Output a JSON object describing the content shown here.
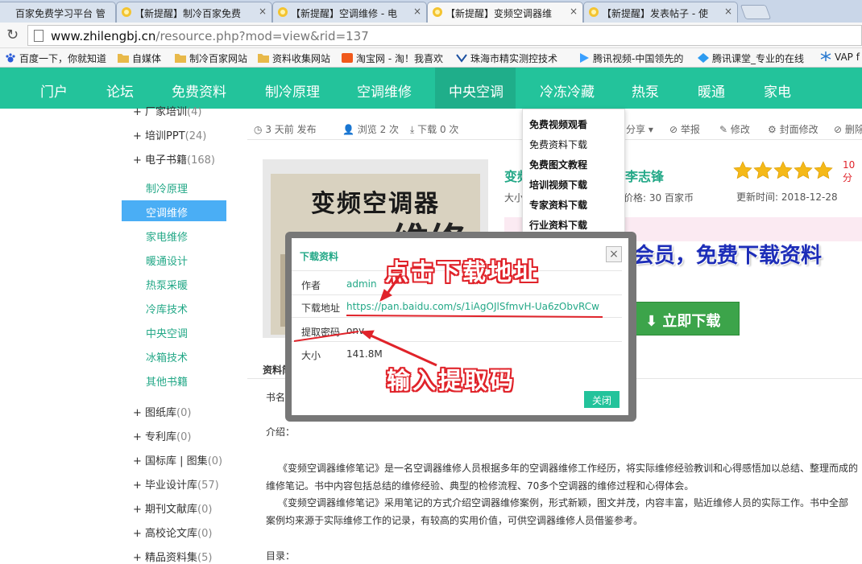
{
  "tabs": [
    {
      "label": "百家免费学习平台 管"
    },
    {
      "label": "【新提醒】制冷百家免费"
    },
    {
      "label": "【新提醒】空调维修 - 电"
    },
    {
      "label": "【新提醒】变频空调器维"
    },
    {
      "label": "【新提醒】发表帖子 - 使"
    }
  ],
  "address": {
    "domain": "www.zhilengbj.cn",
    "path": "/resource.php?mod=view&rid=137"
  },
  "bookmarks": [
    "百度一下，你就知道",
    "自媒体",
    "制冷百家网站",
    "资料收集网站",
    "淘宝网 - 淘！我喜欢",
    "珠海市精实测控技术",
    "腾讯视频-中国领先的",
    "腾讯课堂_专业的在线",
    "VAP f"
  ],
  "nav": [
    "门户",
    "论坛",
    "免费资料",
    "制冷原理",
    "空调维修",
    "中央空调",
    "冷冻冷藏",
    "热泵",
    "暖通",
    "家电"
  ],
  "sidebar": {
    "top": [
      {
        "label": "厂家培训",
        "count": "(4)"
      },
      {
        "label": "培训PPT",
        "count": "(24)"
      },
      {
        "label": "电子书籍",
        "count": "(168)"
      }
    ],
    "subs": [
      "制冷原理",
      "空调维修",
      "家电维修",
      "暖通设计",
      "热泵采暖",
      "冷库技术",
      "中央空调",
      "冰箱技术",
      "其他书籍"
    ],
    "bottom": [
      {
        "label": "图纸库",
        "count": "(0)"
      },
      {
        "label": "专利库",
        "count": "(0)"
      },
      {
        "label": "国标库 | 图集",
        "count": "(0)"
      },
      {
        "label": "毕业设计库",
        "count": "(57)"
      },
      {
        "label": "期刊文献库",
        "count": "(0)"
      },
      {
        "label": "高校论文库",
        "count": "(0)"
      },
      {
        "label": "精品资料集",
        "count": "(5)"
      }
    ]
  },
  "meta": {
    "time": "3 天前 发布",
    "views": "浏览 2 次",
    "downloads": "下载 0 次",
    "share": "分享",
    "report": "举报",
    "edit": "修改",
    "cover": "封面修改",
    "delete": "删除"
  },
  "dropdown": [
    "免费视频观看",
    "免费资料下载",
    "免费图文教程",
    "培训视频下载",
    "专家资料下载",
    "行业资料下载"
  ],
  "resource": {
    "title_start": "变频",
    "author": "李志锋",
    "size_label": "大小",
    "price": "价格: 30 百家币",
    "score": "10",
    "score_unit": "分",
    "updated": "更新时间: 2018-12-28",
    "promo": "会员，免费下载资料",
    "download_btn": "立即下载",
    "book_cover_title": "变频空调器",
    "book_cover_sub": "维修",
    "section": "资料简",
    "bookname_label": "书名：",
    "intro_label": "介绍：",
    "toc_label": "目录："
  },
  "modal": {
    "title": "下载资料",
    "author_label": "作者",
    "author": "admin",
    "url_label": "下载地址",
    "url": "https://pan.baidu.com/s/1iAgOJlSfmvH-Ua6zObvRCw",
    "code_label": "提取密码",
    "code": "onv",
    "size_label": "大小",
    "size": "141.8M",
    "close": "关闭"
  },
  "annotations": {
    "click": "点击下载地址",
    "input": "输入提取码"
  },
  "intro": {
    "p1": "《变频空调器维修笔记》是一名空调器维修人员根据多年的空调器维修工作经历，将实际维修经验教训和心得感悟加以总结、整理而成的",
    "p1b": "维修笔记。书中内容包括总结的维修经验、典型的检修流程、70多个空调器的维修过程和心得体会。",
    "p2": "《变频空调器维修笔记》采用笔记的方式介绍空调器维修案例，形式新颖，图文并茂，内容丰富，贴近维修人员的实际工作。书中全部",
    "p2b": "案例均来源于实际维修工作的记录，有较高的实用价值，可供空调器维修人员借鉴参考。"
  },
  "colors": {
    "accent": "#23c39b",
    "link": "#23a887",
    "selected": "#4aaef5",
    "annotation": "#e0232a",
    "download": "#3ca44a"
  }
}
